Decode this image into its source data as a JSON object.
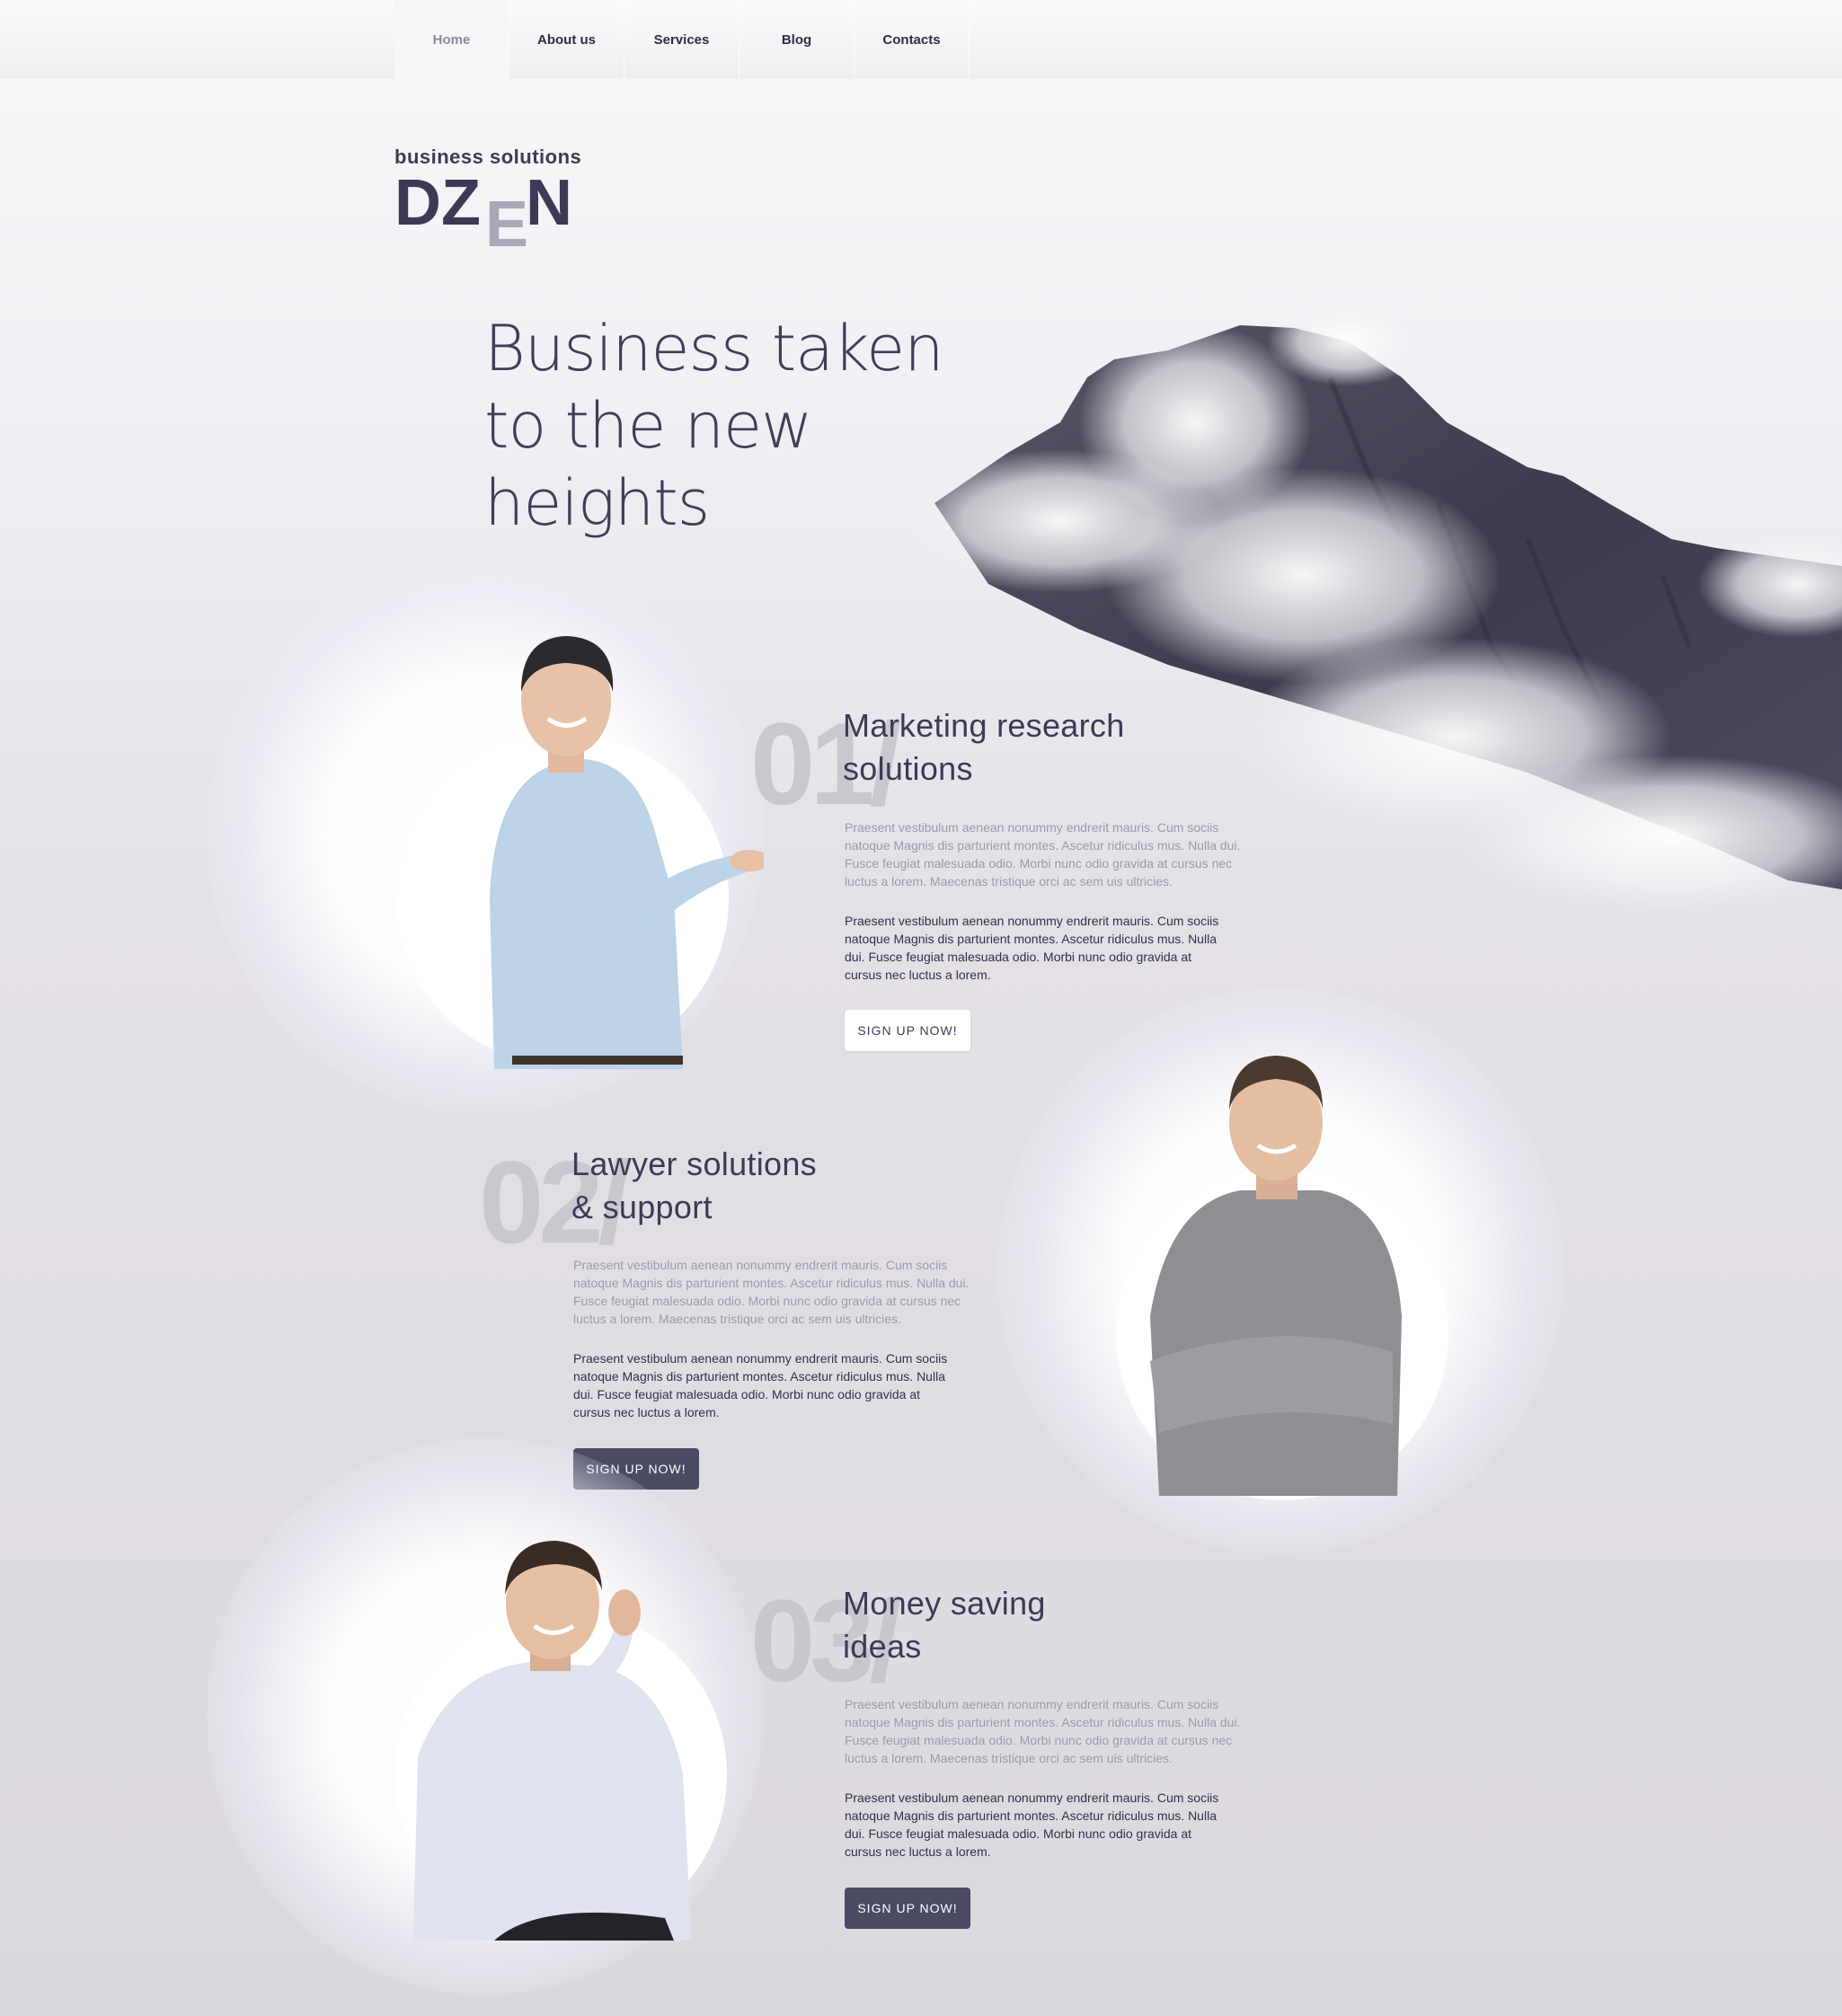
{
  "nav": {
    "items": [
      {
        "label": "Home",
        "active": true
      },
      {
        "label": "About us",
        "active": false
      },
      {
        "label": "Services",
        "active": false
      },
      {
        "label": "Blog",
        "active": false
      },
      {
        "label": "Contacts",
        "active": false
      }
    ]
  },
  "logo": {
    "tagline": "business solutions",
    "word_left": "DZ",
    "word_e": "E",
    "word_right": "N"
  },
  "hero": {
    "lines": [
      "Business taken",
      "to the new",
      "heights"
    ]
  },
  "features": [
    {
      "number": "01/",
      "title": "Marketing research\nsolutions",
      "text_muted": "Praesent vestibulum aenean nonummy endrerit mauris. Cum sociis natoque Magnis dis parturient montes. Ascetur ridiculus mus. Nulla dui. Fusce feugiat malesuada odio. Morbi nunc odio gravida at cursus nec luctus a lorem. Maecenas tristique orci ac sem uis ultricies.",
      "text_dark": "Praesent vestibulum aenean nonummy endrerit mauris. Cum sociis natoque Magnis dis parturient montes. Ascetur ridiculus mus. Nulla dui. Fusce feugiat malesuada odio. Morbi nunc odio gravida at cursus nec luctus a lorem.",
      "button": "SIGN UP NOW!"
    },
    {
      "number": "02/",
      "title": "Lawyer solutions\n& support",
      "text_muted": "Praesent vestibulum aenean nonummy endrerit mauris. Cum sociis natoque Magnis dis parturient montes. Ascetur ridiculus mus. Nulla dui. Fusce feugiat malesuada odio. Morbi nunc odio gravida at cursus nec luctus a lorem. Maecenas tristique orci ac sem uis ultricies.",
      "text_dark": "Praesent vestibulum aenean nonummy endrerit mauris. Cum sociis natoque Magnis dis parturient montes. Ascetur ridiculus mus. Nulla dui. Fusce feugiat malesuada odio. Morbi nunc odio gravida at cursus nec luctus a lorem.",
      "button": "SIGN UP NOW!"
    },
    {
      "number": "03/",
      "title": "Money saving\nideas",
      "text_muted": "Praesent vestibulum aenean nonummy endrerit mauris. Cum sociis natoque Magnis dis parturient montes. Ascetur ridiculus mus. Nulla dui. Fusce feugiat malesuada odio. Morbi nunc odio gravida at cursus nec luctus a lorem. Maecenas tristique orci ac sem uis ultricies.",
      "text_dark": "Praesent vestibulum aenean nonummy endrerit mauris. Cum sociis natoque Magnis dis parturient montes. Ascetur ridiculus mus. Nulla dui. Fusce feugiat malesuada odio. Morbi nunc odio gravida at cursus nec luctus a lorem.",
      "button": "SIGN UP NOW!"
    }
  ],
  "colors": {
    "text_dark": "#3b3b55",
    "text_muted": "#9c9aab",
    "button_dark": "#4a4a64",
    "mountain": "#454256"
  },
  "icons": {
    "background": "mountain-with-clouds-image",
    "person_1": "smiling-man-presenting-photo",
    "person_2": "man-arms-crossed-photo",
    "person_3": "man-thinking-photo"
  }
}
